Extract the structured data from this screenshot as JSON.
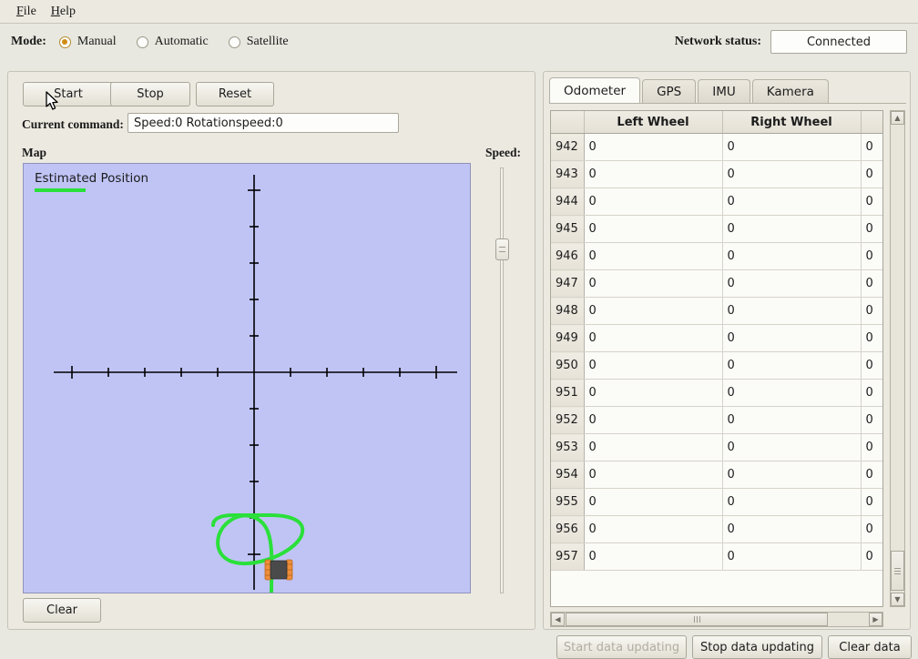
{
  "menu": {
    "items": [
      {
        "label": "File",
        "mnemonic": "F"
      },
      {
        "label": "Help",
        "mnemonic": "H"
      }
    ]
  },
  "mode_bar": {
    "label": "Mode:",
    "options": [
      {
        "label": "Manual",
        "selected": true
      },
      {
        "label": "Automatic",
        "selected": false
      },
      {
        "label": "Satellite",
        "selected": false
      }
    ],
    "network_label": "Network status:",
    "network_value": "Connected"
  },
  "control_panel": {
    "start_label": "Start",
    "stop_label": "Stop",
    "reset_label": "Reset",
    "command_label": "Current command:",
    "command_value": "Speed:0 Rotationspeed:0",
    "map_label": "Map",
    "map_legend": "Estimated Position",
    "speed_label": "Speed:",
    "clear_label": "Clear"
  },
  "map": {
    "background_color": "#c0c4f5",
    "track_color": "#2ae03a",
    "axis_color": "#000000",
    "robot_body_color": "#4a4a4a",
    "robot_track_color": "#ef8d3a"
  },
  "data_panel": {
    "tabs": [
      {
        "label": "Odometer",
        "active": true
      },
      {
        "label": "GPS",
        "active": false
      },
      {
        "label": "IMU",
        "active": false
      },
      {
        "label": "Kamera",
        "active": false
      }
    ],
    "columns": [
      "",
      "Left Wheel",
      "Right Wheel",
      ""
    ],
    "rows": [
      {
        "index": "942",
        "left": "0",
        "right": "0",
        "extra": "0"
      },
      {
        "index": "943",
        "left": "0",
        "right": "0",
        "extra": "0"
      },
      {
        "index": "944",
        "left": "0",
        "right": "0",
        "extra": "0"
      },
      {
        "index": "945",
        "left": "0",
        "right": "0",
        "extra": "0"
      },
      {
        "index": "946",
        "left": "0",
        "right": "0",
        "extra": "0"
      },
      {
        "index": "947",
        "left": "0",
        "right": "0",
        "extra": "0"
      },
      {
        "index": "948",
        "left": "0",
        "right": "0",
        "extra": "0"
      },
      {
        "index": "949",
        "left": "0",
        "right": "0",
        "extra": "0"
      },
      {
        "index": "950",
        "left": "0",
        "right": "0",
        "extra": "0"
      },
      {
        "index": "951",
        "left": "0",
        "right": "0",
        "extra": "0"
      },
      {
        "index": "952",
        "left": "0",
        "right": "0",
        "extra": "0"
      },
      {
        "index": "953",
        "left": "0",
        "right": "0",
        "extra": "0"
      },
      {
        "index": "954",
        "left": "0",
        "right": "0",
        "extra": "0"
      },
      {
        "index": "955",
        "left": "0",
        "right": "0",
        "extra": "0"
      },
      {
        "index": "956",
        "left": "0",
        "right": "0",
        "extra": "0"
      },
      {
        "index": "957",
        "left": "0",
        "right": "0",
        "extra": "0"
      }
    ],
    "start_updating_label": "Start data updating",
    "start_updating_enabled": false,
    "stop_updating_label": "Stop data updating",
    "clear_data_label": "Clear data"
  }
}
